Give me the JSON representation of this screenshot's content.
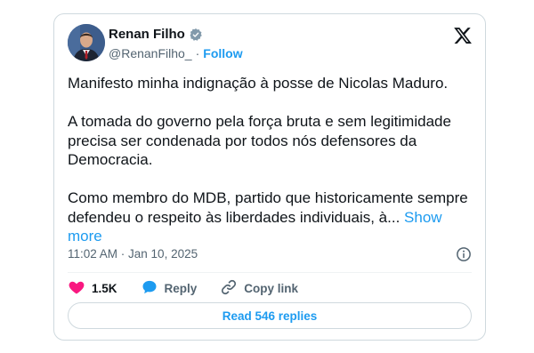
{
  "author": {
    "name": "Renan Filho",
    "handle": "@RenanFilho_",
    "separator": "·",
    "follow_label": "Follow",
    "verified": true
  },
  "tweet": {
    "paragraphs": [
      "Manifesto minha indignação à posse de Nicolas Maduro.",
      "A tomada do governo pela força bruta e sem legitimidade precisa ser condenada por todos nós defensores da Democracia.",
      "Como membro do MDB, partido que historicamente sempre defendeu o respeito às liberdades individuais, à..."
    ],
    "show_more_label": "Show more",
    "timestamp": "11:02 AM · Jan 10, 2025"
  },
  "actions": {
    "like_count": "1.5K",
    "reply_label": "Reply",
    "copy_link_label": "Copy link"
  },
  "replies_button_label": "Read 546 replies",
  "colors": {
    "accent": "#1d9bf0",
    "like": "#f91880",
    "border": "#cfd9de",
    "text": "#0f1419",
    "muted": "#536471"
  },
  "icons": [
    "verified-badge-icon",
    "x-logo-icon",
    "info-icon",
    "heart-icon",
    "reply-bubble-icon",
    "link-icon"
  ]
}
